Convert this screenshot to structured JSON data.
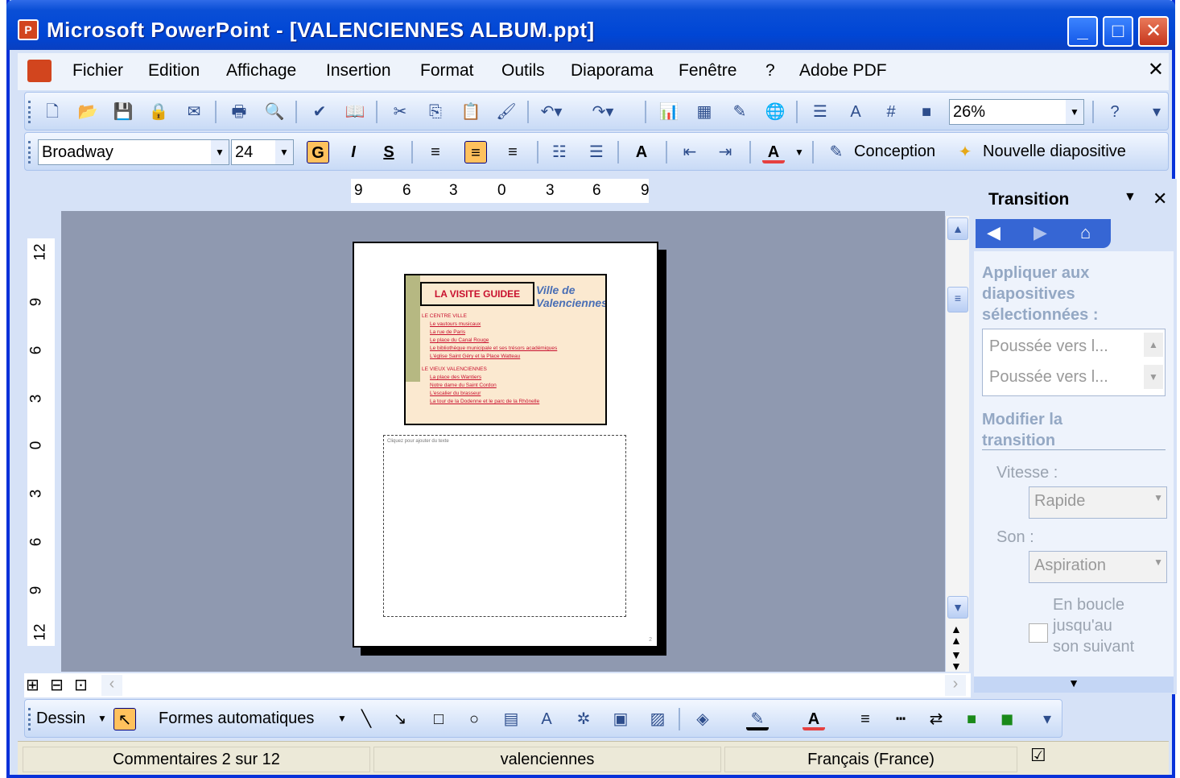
{
  "window": {
    "title": "Microsoft PowerPoint - [VALENCIENNES ALBUM.ppt]"
  },
  "menubar": {
    "items": [
      "Fichier",
      "Edition",
      "Affichage",
      "Insertion",
      "Format",
      "Outils",
      "Diaporama",
      "Fenêtre",
      "?",
      "Adobe PDF"
    ]
  },
  "toolbar_standard": {
    "zoom": "26%"
  },
  "toolbar_format": {
    "font": "Broadway",
    "size": "24",
    "bold": "G",
    "italic": "I",
    "shadow": "S",
    "design_label": "Conception",
    "new_slide_label": "Nouvelle diapositive"
  },
  "ruler": {
    "top": [
      "9",
      "6",
      "3",
      "0",
      "3",
      "6",
      "9"
    ],
    "left": [
      "12",
      "9",
      "6",
      "3",
      "0",
      "3",
      "6",
      "9",
      "12"
    ]
  },
  "slide": {
    "title": "LA VISITE GUIDEE",
    "logo_text": "Ville de Valenciennes",
    "section1": "LE CENTRE VILLE",
    "items1": [
      "Le vautours musicaux",
      "La rue de Paris",
      "Le place du Canal Rouge",
      "Le bibliothèque municipale et ses trésors académiques",
      "L'église Saint Géry et la Place Watteau"
    ],
    "section2": "LE VIEUX VALENCIENNES",
    "items2": [
      "La place des Wantiers",
      "Notre dame du Saint Cordon",
      "L'escalier du brasseur",
      "La tour de la Dodenne et le parc de la Rhônelle"
    ],
    "notes_placeholder": "Cliquez pour ajouter du texte",
    "page_number": "2"
  },
  "taskpane": {
    "title": "Transition",
    "apply_heading": "Appliquer aux diapositives sélectionnées :",
    "list": [
      "Poussée vers l...",
      "Poussée vers l..."
    ],
    "modify_heading": "Modifier la transition",
    "speed_label": "Vitesse :",
    "speed_value": "Rapide",
    "sound_label": "Son :",
    "sound_value": "Aspiration",
    "loop_label": "En boucle jusqu'au son suivant"
  },
  "drawbar": {
    "draw_label": "Dessin",
    "autoshapes_label": "Formes automatiques"
  },
  "statusbar": {
    "notes": "Commentaires 2 sur 12",
    "design": "valenciennes",
    "language": "Français (France)"
  }
}
